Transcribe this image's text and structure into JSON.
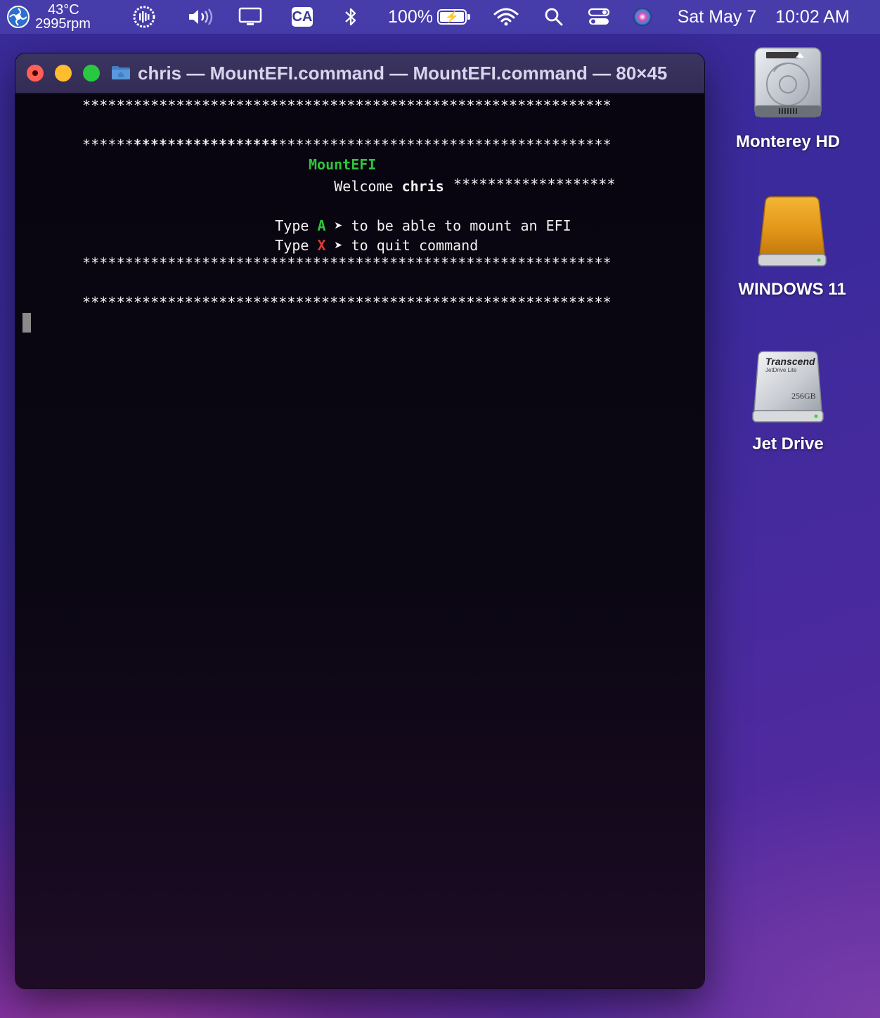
{
  "menubar": {
    "temp": "43°C",
    "rpm": "2995rpm",
    "input_source": "CA",
    "battery_percent": "100%",
    "battery_level": 1.0,
    "date": "Sat May 7",
    "time": "10:02 AM"
  },
  "window": {
    "title": "chris — MountEFI.command — MountEFI.command — 80×45"
  },
  "terminal": {
    "stars_full": "**************************************************************",
    "stars_left": "*****************",
    "stars_right": "*******************",
    "app_name": "MountEFI",
    "welcome_word": "Welcome",
    "user": "chris",
    "type_word": "Type",
    "opt_a_key": "A",
    "opt_a_text": "➤ to be able to mount an EFI",
    "opt_x_key": "X",
    "opt_x_text": "➤ to quit command"
  },
  "desktop": {
    "icons": [
      {
        "label": "Monterey HD"
      },
      {
        "label": "WINDOWS 11"
      },
      {
        "label": "Jet Drive",
        "brand": "Transcend",
        "model": "JetDrive Lite",
        "capacity": "256GB"
      }
    ]
  },
  "colors": {
    "accent_green": "#2fc53c",
    "accent_red": "#e13a2f",
    "close": "#ff5f57",
    "minimize": "#febc2e",
    "maximize": "#28c840"
  }
}
